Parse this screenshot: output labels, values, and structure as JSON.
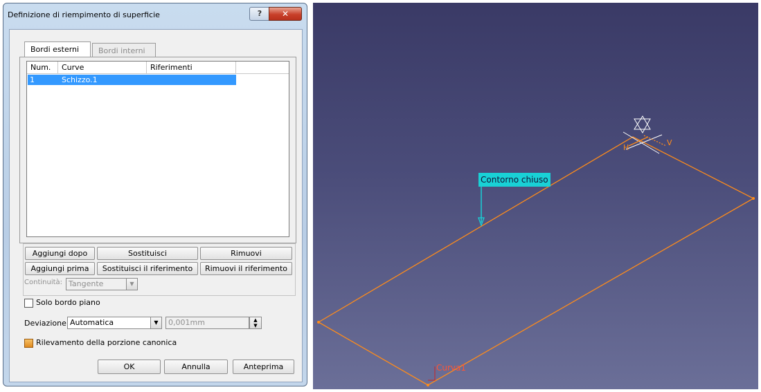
{
  "dialog": {
    "title": "Definizione di riempimento di superficie",
    "help": "?",
    "close": "✕",
    "tabs": [
      {
        "label": "Bordi esterni",
        "active": true
      },
      {
        "label": "Bordi interni",
        "active": false
      }
    ],
    "list": {
      "columns": [
        "Num.",
        "Curve",
        "Riferimenti"
      ],
      "rows": [
        {
          "num": "1",
          "curve": "Schizzo.1",
          "ref": ""
        }
      ]
    },
    "buttons": {
      "add_after": "Aggiungi dopo",
      "replace": "Sostituisci",
      "remove": "Rimuovi",
      "add_before": "Aggiungi prima",
      "replace_ref": "Sostituisci il riferimento",
      "remove_ref": "Rimuovi il riferimento"
    },
    "continuity": {
      "label": "Continuità:",
      "value": "Tangente"
    },
    "plane_only": {
      "label": "Solo bordo piano",
      "checked": false
    },
    "deviation": {
      "label": "Deviazione:",
      "mode": "Automatica",
      "value": "0,001mm"
    },
    "canonical": {
      "label": "Rilevamento della porzione canonica",
      "checked": true
    },
    "footer": {
      "ok": "OK",
      "cancel": "Annulla",
      "preview": "Anteprima"
    }
  },
  "viewport": {
    "callout": "Contorno chiuso",
    "curve_label": "Curva1",
    "axis_h": "H",
    "axis_v": "V",
    "colors": {
      "edge": "#ff8c1a",
      "callout": "#19d1d6",
      "background": "#3f4070"
    }
  }
}
